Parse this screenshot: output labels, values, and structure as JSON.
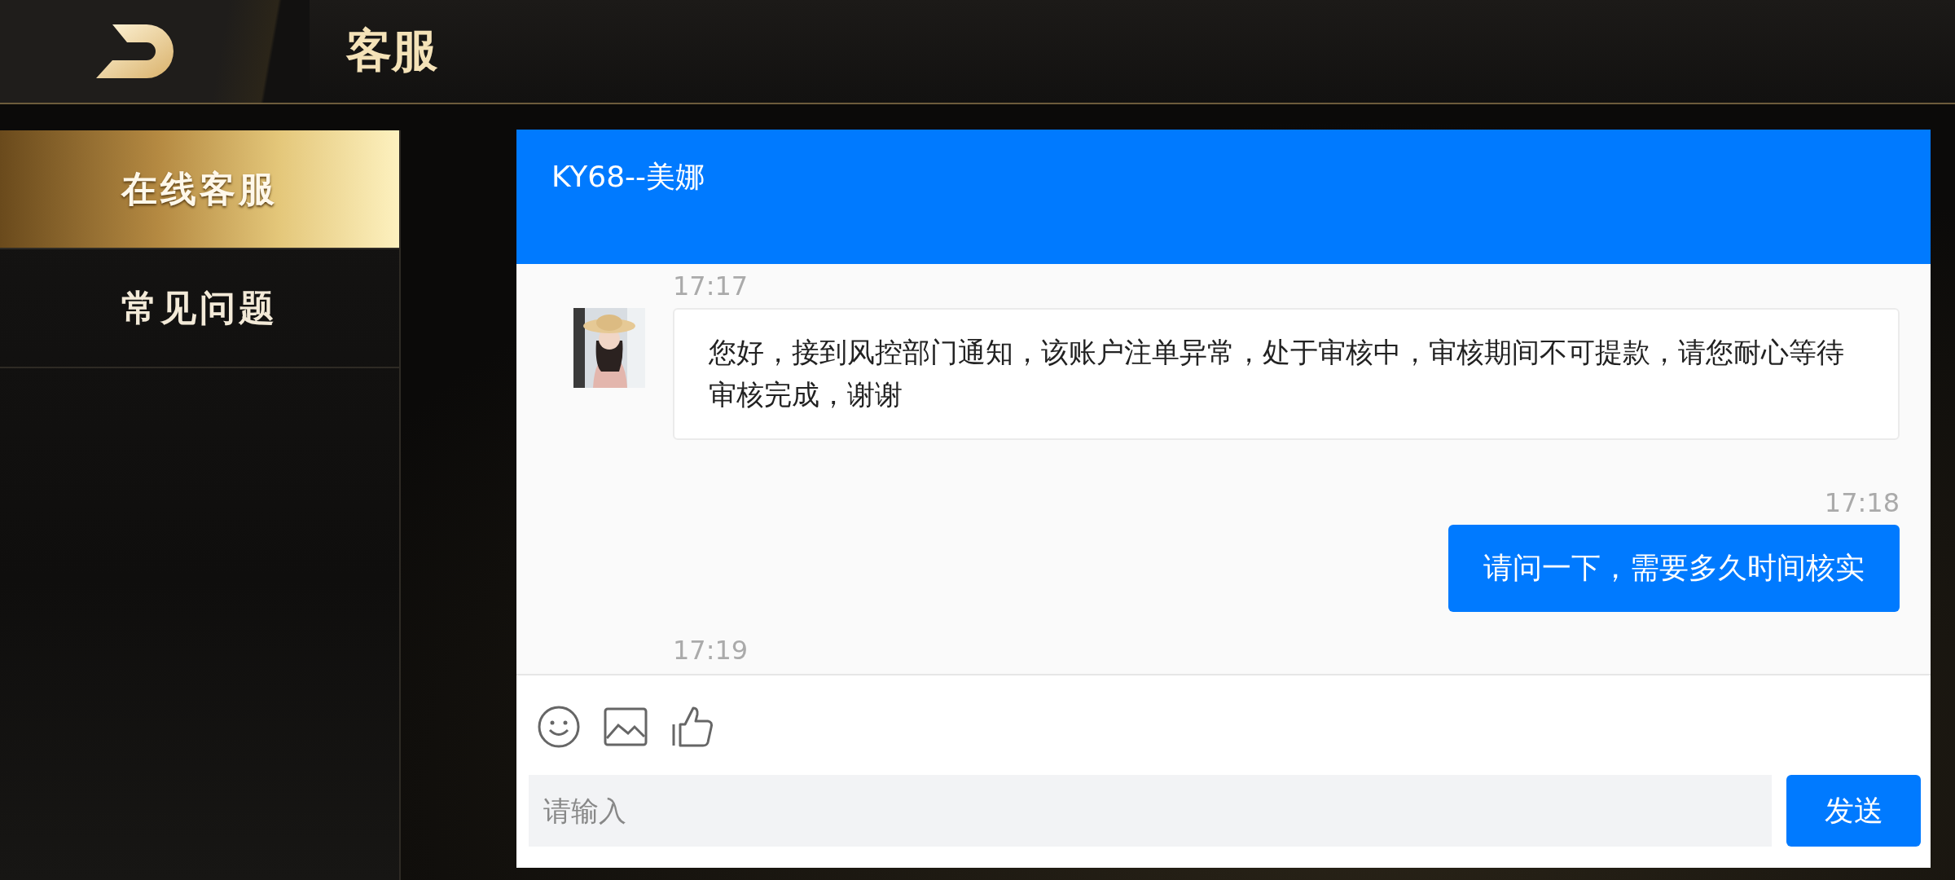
{
  "header": {
    "title": "客服"
  },
  "sidebar": {
    "items": [
      {
        "label": "在线客服",
        "selected": true
      },
      {
        "label": "常见问题",
        "selected": false
      }
    ]
  },
  "chat": {
    "title": "KY68--美娜",
    "messages": [
      {
        "kind": "agent",
        "time": "17:17",
        "text": "您好，接到风控部门通知，该账户注单异常，处于审核中，审核期间不可提款，请您耐心等待审核完成，谢谢"
      },
      {
        "kind": "user",
        "time": "17:18",
        "text": "请问一下，需要多久时间核实"
      },
      {
        "kind": "agent",
        "time": "17:19"
      }
    ]
  },
  "composer": {
    "placeholder": "请输入",
    "send": "发送"
  }
}
